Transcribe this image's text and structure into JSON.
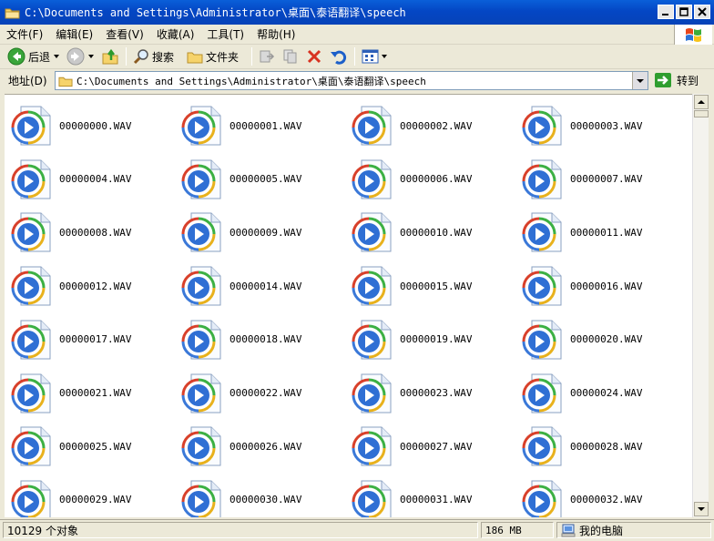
{
  "window": {
    "title": "C:\\Documents and Settings\\Administrator\\桌面\\泰语翻译\\speech"
  },
  "menu": [
    {
      "label": "文件(F)"
    },
    {
      "label": "编辑(E)"
    },
    {
      "label": "查看(V)"
    },
    {
      "label": "收藏(A)"
    },
    {
      "label": "工具(T)"
    },
    {
      "label": "帮助(H)"
    }
  ],
  "toolbar": {
    "back_label": "后退",
    "search_label": "搜索",
    "folders_label": "文件夹"
  },
  "address": {
    "label": "地址(D)",
    "value": "C:\\Documents and Settings\\Administrator\\桌面\\泰语翻译\\speech",
    "go_label": "转到"
  },
  "files": [
    "00000000.WAV",
    "00000001.WAV",
    "00000002.WAV",
    "00000003.WAV",
    "00000004.WAV",
    "00000005.WAV",
    "00000006.WAV",
    "00000007.WAV",
    "00000008.WAV",
    "00000009.WAV",
    "00000010.WAV",
    "00000011.WAV",
    "00000012.WAV",
    "00000014.WAV",
    "00000015.WAV",
    "00000016.WAV",
    "00000017.WAV",
    "00000018.WAV",
    "00000019.WAV",
    "00000020.WAV",
    "00000021.WAV",
    "00000022.WAV",
    "00000023.WAV",
    "00000024.WAV",
    "00000025.WAV",
    "00000026.WAV",
    "00000027.WAV",
    "00000028.WAV",
    "00000029.WAV",
    "00000030.WAV",
    "00000031.WAV",
    "00000032.WAV"
  ],
  "status": {
    "count": "10129 个对象",
    "size": "186 MB",
    "zone": "我的电脑"
  },
  "colors": {
    "titlebar": "#0a5fd9",
    "chrome": "#ece9d8",
    "go_green": "#2f9e2f"
  }
}
